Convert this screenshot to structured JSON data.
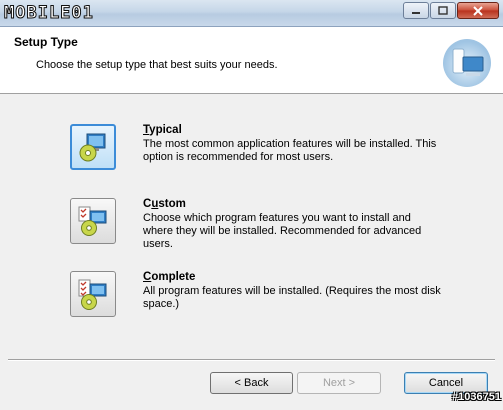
{
  "window": {
    "logo_text": "MOBILE01",
    "minimize_icon": "minimize-icon",
    "maximize_icon": "maximize-icon",
    "close_icon": "close-icon"
  },
  "header": {
    "title": "Setup Type",
    "subtitle": "Choose the setup type that best suits your needs.",
    "icon": "computer-setup-icon"
  },
  "options": [
    {
      "title": "Typical",
      "accel": "T",
      "description": "The most common application features will be installed. This option is recommended for most users.",
      "selected": true,
      "icon": "typical-setup-icon"
    },
    {
      "title": "Custom",
      "accel": "u",
      "description": "Choose which program features you want to install and where they will be installed. Recommended for advanced users.",
      "selected": false,
      "icon": "custom-setup-icon"
    },
    {
      "title": "Complete",
      "accel": "C",
      "description": "All program features will be installed. (Requires the most disk space.)",
      "selected": false,
      "icon": "complete-setup-icon"
    }
  ],
  "buttons": {
    "back": "< Back",
    "next": "Next >",
    "cancel": "Cancel"
  },
  "watermark": "#1036751",
  "colors": {
    "accent": "#3c8cd8",
    "dialog_bg": "#f0f0f0"
  }
}
